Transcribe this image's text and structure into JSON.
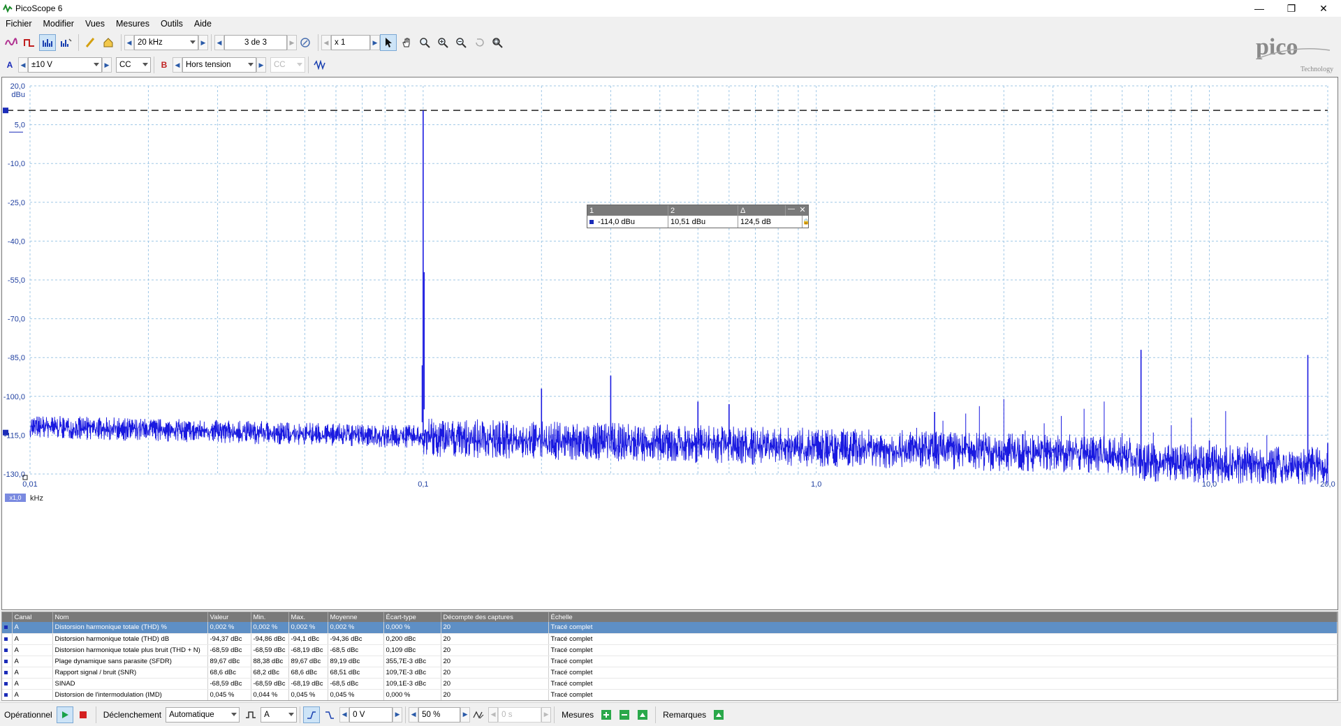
{
  "window": {
    "title": "PicoScope 6"
  },
  "menu": [
    "Fichier",
    "Modifier",
    "Vues",
    "Mesures",
    "Outils",
    "Aide"
  ],
  "toolbar": {
    "bandwidth": "20 kHz",
    "capture": "3 de 3",
    "zoom": "x 1"
  },
  "channels": {
    "a_label": "A",
    "a_range": "±10 V",
    "a_coupling": "CC",
    "b_label": "B",
    "b_range": "Hors tension",
    "b_coupling": "CC"
  },
  "plot": {
    "y_unit": "dBu",
    "x_unit": "kHz",
    "x_scale_badge": "x1,0",
    "y_ticks": [
      "20,0",
      "5,0",
      "-10,0",
      "-25,0",
      "-40,0",
      "-55,0",
      "-70,0",
      "-85,0",
      "-100,0",
      "-115,0",
      "-130,0"
    ],
    "x_ticks": [
      "0,01",
      "0,1",
      "1,0",
      "10,0",
      "20,0"
    ],
    "ruler_level_dbu": 10.51
  },
  "cursor_box": {
    "h1": "1",
    "h2": "2",
    "h3": "Δ",
    "v1": "-114,0 dBu",
    "v2": "10,51 dBu",
    "v3": "124,5 dB"
  },
  "measurements": {
    "headers": [
      "Canal",
      "Nom",
      "Valeur",
      "Min.",
      "Max.",
      "Moyenne",
      "Écart-type",
      "Décompte des captures",
      "Échelle"
    ],
    "rows": [
      [
        "A",
        "Distorsion harmonique totale (THD) %",
        "0,002 %",
        "0,002 %",
        "0,002 %",
        "0,002 %",
        "0,000 %",
        "20",
        "Tracé complet"
      ],
      [
        "A",
        "Distorsion harmonique totale (THD) dB",
        "-94,37 dBc",
        "-94,86 dBc",
        "-94,1 dBc",
        "-94,36 dBc",
        "0,200 dBc",
        "20",
        "Tracé complet"
      ],
      [
        "A",
        "Distorsion harmonique totale plus bruit (THD + N)",
        "-68,59 dBc",
        "-68,59 dBc",
        "-68,19 dBc",
        "-68,5 dBc",
        "0,109 dBc",
        "20",
        "Tracé complet"
      ],
      [
        "A",
        "Plage dynamique sans parasite (SFDR)",
        "89,67 dBc",
        "88,38 dBc",
        "89,67 dBc",
        "89,19 dBc",
        "355,7E-3 dBc",
        "20",
        "Tracé complet"
      ],
      [
        "A",
        "Rapport signal / bruit (SNR)",
        "68,6 dBc",
        "68,2 dBc",
        "68,6 dBc",
        "68,51 dBc",
        "109,7E-3 dBc",
        "20",
        "Tracé complet"
      ],
      [
        "A",
        "SINAD",
        "-68,59 dBc",
        "-68,59 dBc",
        "-68,19 dBc",
        "-68,5 dBc",
        "109,1E-3 dBc",
        "20",
        "Tracé complet"
      ],
      [
        "A",
        "Distorsion de l'intermodulation (IMD)",
        "0,045 %",
        "0,044 %",
        "0,045 %",
        "0,045 %",
        "0,000 %",
        "20",
        "Tracé complet"
      ]
    ]
  },
  "status": {
    "mode": "Opérationnel",
    "trigger_label": "Déclenchement",
    "trigger_mode": "Automatique",
    "trigger_channel": "A",
    "threshold": "0 V",
    "pretrigger": "50 %",
    "delay": "0 s",
    "measures_label": "Mesures",
    "notes_label": "Remarques"
  },
  "logo": {
    "text": "pico",
    "sub": "Technology"
  },
  "colors": {
    "trace": "#1a1ae0",
    "grid": "#9fc7e6",
    "axis_text": "#1f3fa0"
  },
  "chart_data": {
    "type": "line",
    "x_scale": "log",
    "xlim": [
      0.01,
      20
    ],
    "ylim": [
      -130,
      20
    ],
    "xlabel": "kHz",
    "ylabel": "dBu",
    "series": [
      {
        "x": [
          0.01,
          0.1,
          0.2,
          0.3,
          0.5,
          0.6,
          1.0,
          2.0,
          6.7,
          10.0,
          20.0
        ],
        "y": [
          -112,
          10.5,
          -97,
          -92,
          -102,
          -103,
          -116,
          -106,
          -82,
          -117,
          -118
        ]
      }
    ]
  }
}
